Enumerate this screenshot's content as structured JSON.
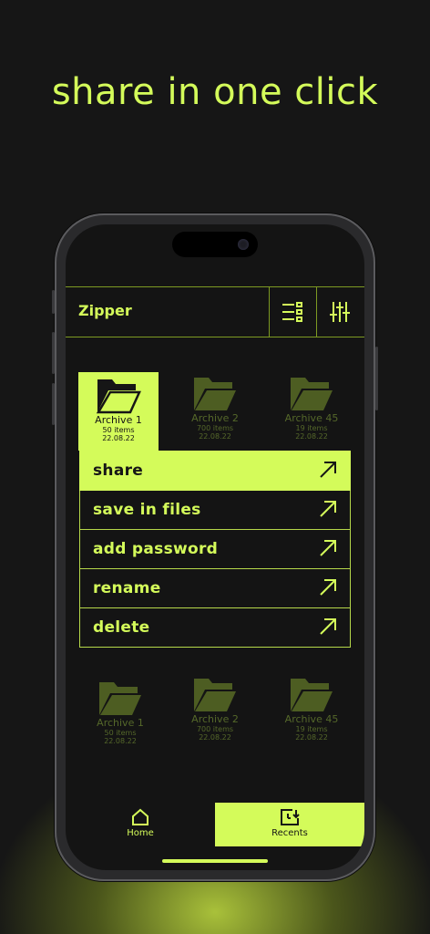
{
  "headline": "share in one click",
  "app": {
    "title": "Zipper"
  },
  "toolbar": {
    "list_view_icon": "list-view-icon",
    "filter_icon": "sliders-icon"
  },
  "folders_top": [
    {
      "name": "Archive 1",
      "items": "50 items",
      "date": "22.08.22",
      "selected": true
    },
    {
      "name": "Archive 2",
      "items": "700 items",
      "date": "22.08.22",
      "selected": false
    },
    {
      "name": "Archive 45",
      "items": "19 items",
      "date": "22.08.22",
      "selected": false
    }
  ],
  "context_menu": [
    {
      "label": "share",
      "highlighted": true
    },
    {
      "label": "save in files",
      "highlighted": false
    },
    {
      "label": "add password",
      "highlighted": false
    },
    {
      "label": "rename",
      "highlighted": false
    },
    {
      "label": "delete",
      "highlighted": false
    }
  ],
  "folders_bottom": [
    {
      "name": "Archive 1",
      "items": "50 items",
      "date": "22.08.22"
    },
    {
      "name": "Archive 2",
      "items": "700 items",
      "date": "22.08.22"
    },
    {
      "name": "Archive 45",
      "items": "19 items",
      "date": "22.08.22"
    }
  ],
  "tabs": [
    {
      "label": "Home",
      "icon": "home-icon",
      "active": false
    },
    {
      "label": "Recents",
      "icon": "recents-icon",
      "active": true
    }
  ],
  "colors": {
    "accent": "#d4fb5a",
    "background": "#141414",
    "muted": "#55682a"
  }
}
